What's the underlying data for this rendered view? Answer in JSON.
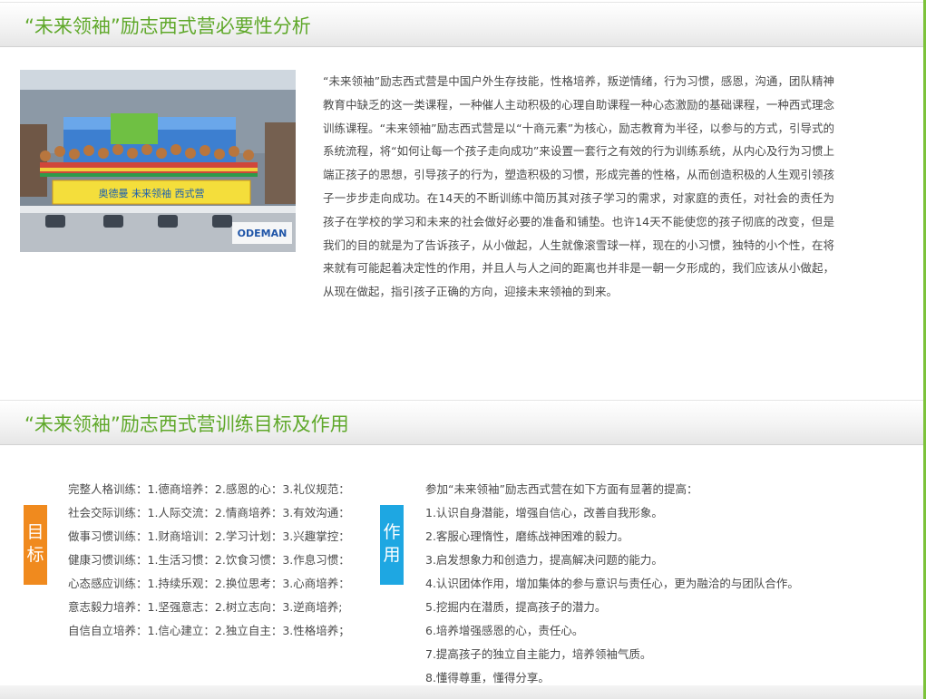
{
  "section1": {
    "title": "“未来领袖”励志西式营必要性分析",
    "photo": {
      "banner_text": "奥德曼 未来领袖 西式营",
      "logo_text": "ODEMAN"
    },
    "intro": "“未来领袖”励志西式营是中国户外生存技能，性格培养，叛逆情绪，行为习惯，感恩，沟通，团队精神教育中缺乏的这一类课程，一种催人主动积极的心理自助课程一种心态激励的基础课程，一种西式理念训练课程。“未来领袖”励志西式营是以“十商元素”为核心，励志教育为半径，以参与的方式，引导式的系统流程，将“如何让每一个孩子走向成功”来设置一套行之有效的行为训练系统，从内心及行为习惯上端正孩子的思想，引导孩子的行为，塑造积极的习惯，形成完善的性格，从而创造积极的人生观引领孩子一步步走向成功。在14天的不断训练中简历其对孩子学习的需求，对家庭的责任，对社会的责任为孩子在学校的学习和未来的社会做好必要的准备和铺垫。也许14天不能使您的孩子彻底的改变，但是我们的目的就是为了告诉孩子，从小做起，人生就像滚雪球一样，现在的小习惯，独特的小个性，在将来就有可能起着决定性的作用，并且人与人之间的距离也并非是一朝一夕形成的，我们应该从小做起，从现在做起，指引孩子正确的方向，迎接未来领袖的到来。"
  },
  "section2": {
    "title": "“未来领袖”励志西式营训练目标及作用",
    "goals_tag": "目标",
    "effects_tag": "作用",
    "goals": [
      "完整人格训练：1.德商培养：2.感恩的心：3.礼仪规范：",
      "社会交际训练：1.人际交流：2.情商培养：3.有效沟通：",
      "做事习惯训练：1.财商培训：2.学习计划：3.兴趣掌控：",
      "健康习惯训练：1.生活习惯：2.饮食习惯：3.作息习惯：",
      "心态感应训练：1.持续乐观：2.换位思考：3.心商培养：",
      "意志毅力培养：1.坚强意志：2.树立志向：3.逆商培养;",
      "自信自立培养：1.信心建立：2.独立自主：3.性格培养；"
    ],
    "effects_intro": "参加“未来领袖”励志西式营在如下方面有显著的提高：",
    "effects": [
      "1.认识自身潜能，增强自信心，改善自我形象。",
      "2.客服心理惰性，磨练战神困难的毅力。",
      "3.启发想象力和创造力，提高解决问题的能力。",
      "4.认识团体作用，增加集体的参与意识与责任心，更为融洽的与团队合作。",
      "5.挖掘内在潜质，提高孩子的潜力。",
      "6.培养增强感恩的心，责任心。",
      "7.提高孩子的独立自主能力，培养领袖气质。",
      "8.懂得尊重，懂得分享。"
    ]
  },
  "colors": {
    "title_green": "#5fa82a",
    "tag_orange": "#f08a1e",
    "tag_blue": "#1ea7e2",
    "body_text": "#4a4a4a"
  }
}
